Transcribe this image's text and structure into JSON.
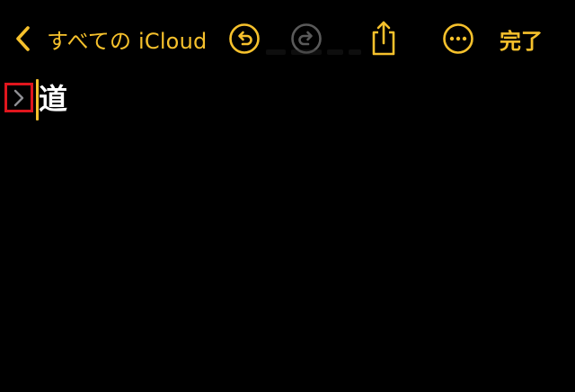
{
  "toolbar": {
    "back": {
      "label": "すべての iCloud",
      "icon": "chevron-left-icon"
    },
    "undo": {
      "icon": "undo-icon",
      "enabled": true
    },
    "redo": {
      "icon": "redo-icon",
      "enabled": false
    },
    "share": {
      "icon": "share-icon"
    },
    "more": {
      "icon": "ellipsis-circle-icon"
    },
    "done_label": "完了"
  },
  "note": {
    "disclosure_icon": "chevron-right-icon",
    "heading": "道"
  },
  "colors": {
    "background": "#000000",
    "accent": "#F6C12C",
    "disabled": "#5A5A5A",
    "text": "#FFFFFF",
    "highlight_box": "#E0161D"
  }
}
